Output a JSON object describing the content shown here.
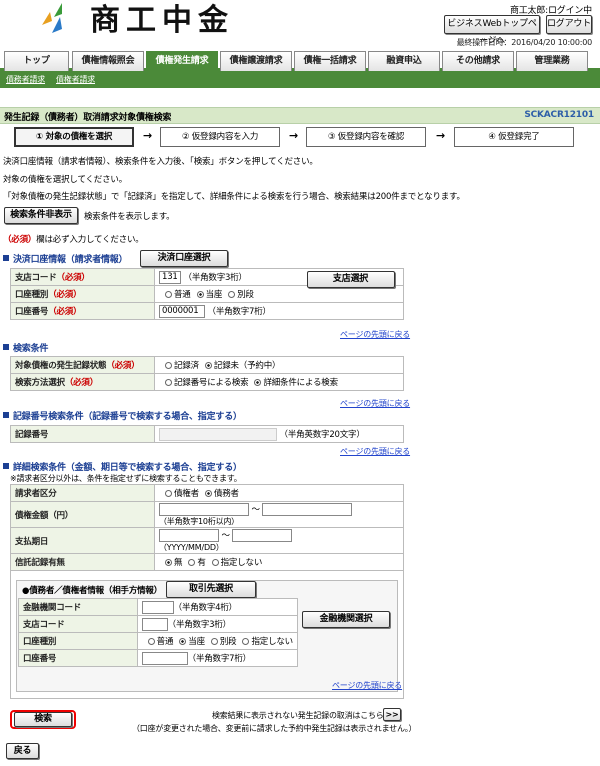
{
  "header": {
    "logo_text": "商工中金",
    "user": "商工太郎:ログイン中",
    "topbtn": "ビジネスWebトップページへ",
    "logout": "ログアウト",
    "last_op": "最終操作日時：2016/04/20 10:00:00"
  },
  "tabs": [
    "トップ",
    "債権情報照会",
    "債権発生請求",
    "債権譲渡請求",
    "債権一括請求",
    "融資申込",
    "その他請求",
    "管理業務"
  ],
  "subnav": [
    "債務者請求",
    "債権者請求"
  ],
  "page": {
    "title": "発生記録（債務者）取消請求対象債権検索",
    "code": "SCKACR12101"
  },
  "steps": [
    "① 対象の債権を選択",
    "② 仮登録内容を入力",
    "③ 仮登録内容を確認",
    "④ 仮登録完了"
  ],
  "intro": {
    "l1": "決済口座情報（請求者情報）、検索条件を入力後、「検索」ボタンを押してください。",
    "l2": "対象の債権を選択してください。",
    "l3": "「対象債権の発生記録状態」で「記録済」を指定して、詳細条件による検索を行う場合、検索結果は200件までとなります。",
    "toggle_btn": "検索条件非表示",
    "toggle_note": "検索条件を表示します。",
    "req_label": "（必須）",
    "req_note": "欄は必ず入力してください。"
  },
  "s1": {
    "title": "決済口座情報（請求者情報）",
    "btn": "決済口座選択",
    "branch_label": "支店コード",
    "branch_value": "131",
    "branch_hint": "（半角数字3桁）",
    "branch_btn": "支店選択",
    "acct_type_label": "口座種別",
    "acct_types": [
      "普通",
      "当座",
      "別段"
    ],
    "acct_no_label": "口座番号",
    "acct_no_value": "0000001",
    "acct_no_hint": "（半角数字7桁）",
    "pagetop": "ページの先頭に戻る"
  },
  "s2": {
    "title": "検索条件",
    "status_label": "対象債権の発生記録状態",
    "status_opts": [
      "記録済",
      "記録未（予約中）"
    ],
    "method_label": "検索方法選択",
    "method_opts": [
      "記録番号による検索",
      "詳細条件による検索"
    ],
    "pagetop": "ページの先頭に戻る"
  },
  "s3": {
    "title": "記録番号検索条件（記録番号で検索する場合、指定する）",
    "rec_label": "記録番号",
    "rec_hint": "（半角英数字20文字）",
    "pagetop": "ページの先頭に戻る"
  },
  "s4": {
    "title": "詳細検索条件（金額、期日等で検索する場合、指定する）",
    "note": "※請求者区分以外は、条件を指定せずに検索することもできます。",
    "role_label": "請求者区分",
    "role_opts": [
      "債権者",
      "債務者"
    ],
    "amount_label": "債権金額（円）",
    "amount_hint": "（半角数字10桁以内）",
    "date_label": "支払期日",
    "date_hint": "（YYYY/MM/DD）",
    "trust_label": "信託記録有無",
    "trust_opts": [
      "無",
      "有",
      "指定しない"
    ],
    "tilde": "～"
  },
  "s5": {
    "title": "●債務者／債権者情報（相手方情報）",
    "btn": "取引先選択",
    "bank_label": "金融機関コード",
    "bank_hint": "（半角数字4桁）",
    "bank_btn": "金融機関選択",
    "branch_label": "支店コード",
    "branch_hint": "（半角数字3桁）",
    "acct_type_label": "口座種別",
    "acct_types": [
      "普通",
      "当座",
      "別段",
      "指定しない"
    ],
    "acct_no_label": "口座番号",
    "acct_no_hint": "（半角数字7桁）",
    "pagetop": "ページの先頭に戻る"
  },
  "footer": {
    "search_btn": "検索",
    "note1": "検索結果に表示されない発生記録の取消はこちらから",
    "next_btn": ">>",
    "note2": "（口座が変更された場合、変更前に請求した予約中発生記録は表示されません。）",
    "back_btn": "戻る"
  }
}
